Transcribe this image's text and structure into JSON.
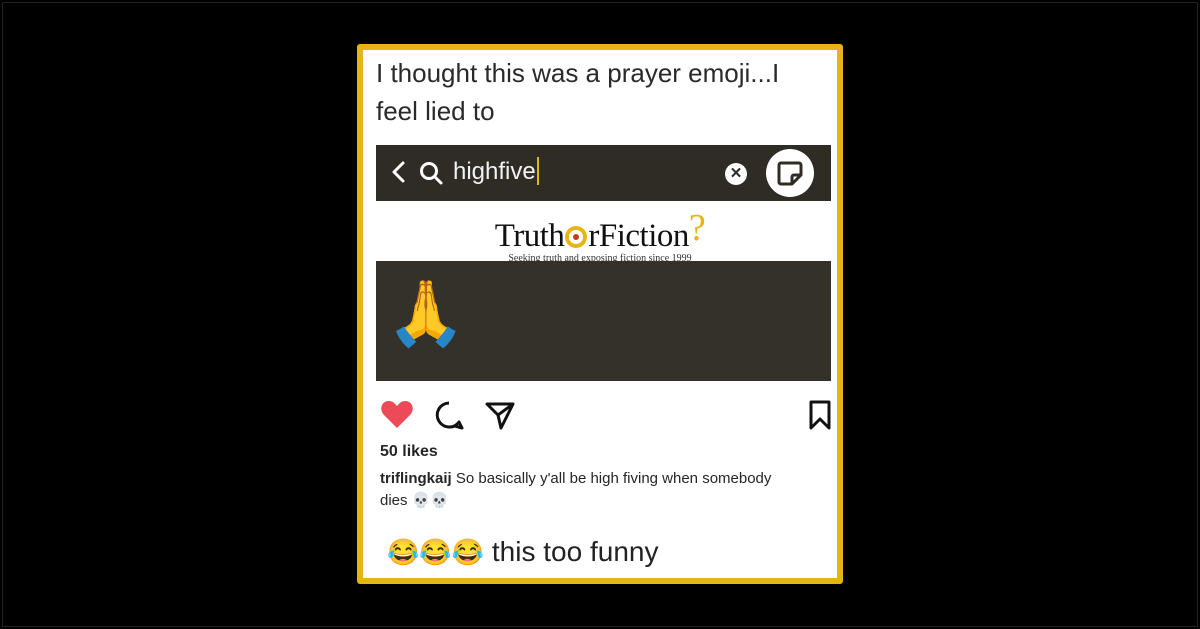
{
  "post": {
    "caption": "I thought this was a prayer emoji...I feel lied to"
  },
  "search_bar": {
    "query": "highfive",
    "back_icon": "chevron-left-icon",
    "search_icon": "magnifier-icon",
    "clear_icon": "close-circle-icon",
    "clear_glyph": "✕",
    "sticker_icon": "sticker-icon"
  },
  "watermark": {
    "brand_prefix": "Truth",
    "brand_suffix": "rFiction",
    "brand_mark": "?",
    "tagline": "Seeking truth and exposing fiction since 1999"
  },
  "emoji_result": {
    "emoji": "🙏"
  },
  "actions": {
    "like_icon": "heart-icon",
    "comment_icon": "comment-icon",
    "share_icon": "paper-plane-icon",
    "save_icon": "bookmark-icon",
    "like_color": "#ed4956"
  },
  "engagement": {
    "likes": "50 likes",
    "comment_user": "triflingkaij",
    "comment_body": "So basically y'all be high fiving when somebody dies 💀💀"
  },
  "footer": {
    "emojis": "😂😂😂",
    "text": "this too funny"
  },
  "colors": {
    "border": "#e7b416",
    "dark_panel": "#2f2c26"
  }
}
